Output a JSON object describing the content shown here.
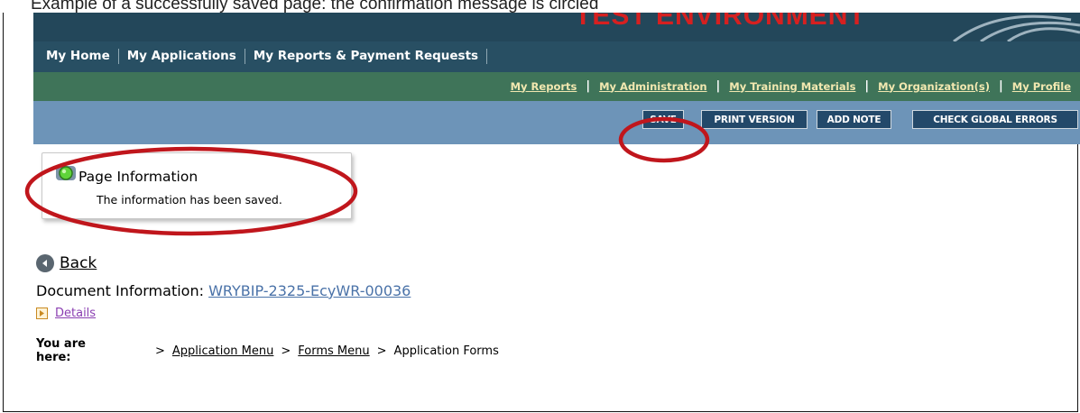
{
  "caption": "Example of a successfully saved page: the confirmation message is circled",
  "banner": {
    "text": "TEST ENVIRONMENT"
  },
  "primary_nav": [
    {
      "label": "My Home"
    },
    {
      "label": "My Applications"
    },
    {
      "label": "My Reports & Payment Requests"
    }
  ],
  "secondary_nav": [
    {
      "label": "My Reports"
    },
    {
      "label": "My Administration"
    },
    {
      "label": "My Training Materials"
    },
    {
      "label": "My Organization(s)"
    },
    {
      "label": "My Profile"
    }
  ],
  "toolbar": {
    "save": "SAVE",
    "print": "PRINT VERSION",
    "add_note": "ADD NOTE",
    "check_errors": "CHECK GLOBAL ERRORS"
  },
  "page_info": {
    "title": "Page Information",
    "message": "The information has been saved."
  },
  "back_label": "Back",
  "document": {
    "label": "Document Information: ",
    "id": "WRYBIP-2325-EcyWR-00036"
  },
  "details_label": "Details",
  "breadcrumb": {
    "label": "You are here:",
    "items": [
      "Application Menu",
      "Forms Menu"
    ],
    "current": "Application Forms"
  },
  "colors": {
    "banner": "#23475a",
    "primary_nav": "#284f63",
    "secondary_nav": "#3f7459",
    "toolbar": "#6d94b8",
    "button": "#23496a",
    "highlight_circle": "#c0161c"
  }
}
